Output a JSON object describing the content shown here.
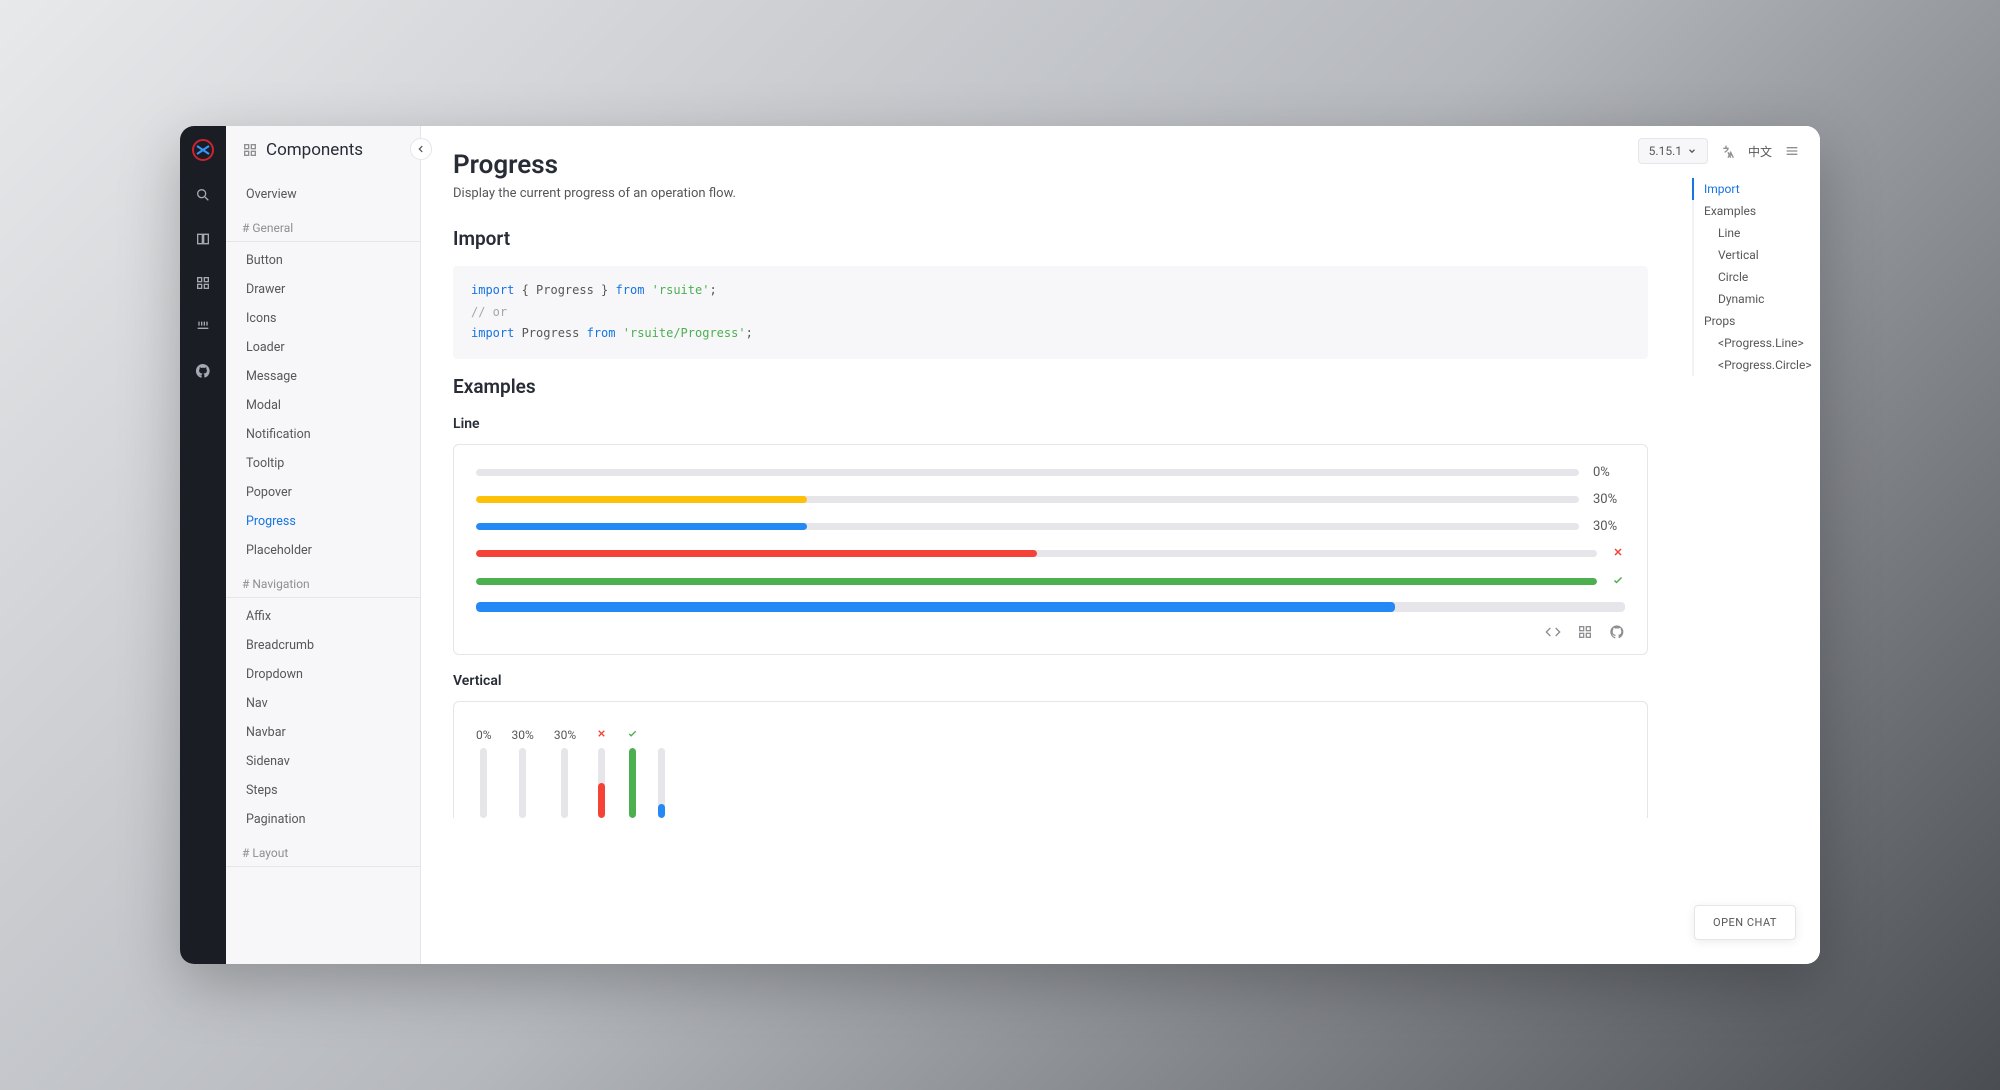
{
  "topbar": {
    "version": "5.15.1",
    "language": "中文",
    "chat_button": "OPEN CHAT"
  },
  "sidebar": {
    "title": "Components",
    "overview": "Overview",
    "sections": [
      {
        "label": "# General",
        "items": [
          "Button",
          "Drawer",
          "Icons",
          "Loader",
          "Message",
          "Modal",
          "Notification",
          "Tooltip",
          "Popover",
          "Progress",
          "Placeholder"
        ],
        "active": "Progress"
      },
      {
        "label": "# Navigation",
        "items": [
          "Affix",
          "Breadcrumb",
          "Dropdown",
          "Nav",
          "Navbar",
          "Sidenav",
          "Steps",
          "Pagination"
        ]
      },
      {
        "label": "# Layout",
        "items": []
      }
    ]
  },
  "page": {
    "title": "Progress",
    "description": "Display the current progress of an operation flow.",
    "h_import": "Import",
    "code_import": "import { Progress } from 'rsuite';\n// or\nimport Progress from 'rsuite/Progress';",
    "h_examples": "Examples",
    "h_line": "Line",
    "h_vertical": "Vertical"
  },
  "examples": {
    "line": [
      {
        "percent": 0,
        "color": "#e5e5ea",
        "label": "0%"
      },
      {
        "percent": 30,
        "color": "#ffc107",
        "label": "30%"
      },
      {
        "percent": 30,
        "color": "#2589f5",
        "label": "30%"
      },
      {
        "percent": 50,
        "color": "#f44336",
        "status": "fail"
      },
      {
        "percent": 100,
        "color": "#4caf50",
        "status": "success"
      },
      {
        "percent": 80,
        "color": "#2589f5",
        "strokeWidth": 10,
        "nolabel": true
      }
    ],
    "vertical": [
      {
        "percent": 0,
        "color": "#e5e5ea",
        "label": "0%"
      },
      {
        "percent": 30,
        "color": "#e5e5ea",
        "label": "30%"
      },
      {
        "percent": 30,
        "color": "#e5e5ea",
        "label": "30%"
      },
      {
        "percent": 50,
        "color": "#f44336",
        "status": "fail"
      },
      {
        "percent": 100,
        "color": "#4caf50",
        "status": "success"
      },
      {
        "percent": 20,
        "color": "#2589f5"
      }
    ]
  },
  "toc": [
    {
      "label": "Import",
      "active": true
    },
    {
      "label": "Examples"
    },
    {
      "label": "Line",
      "sub": true
    },
    {
      "label": "Vertical",
      "sub": true
    },
    {
      "label": "Circle",
      "sub": true
    },
    {
      "label": "Dynamic",
      "sub": true
    },
    {
      "label": "Props"
    },
    {
      "label": "<Progress.Line>",
      "sub": true
    },
    {
      "label": "<Progress.Circle>",
      "sub": true
    }
  ],
  "colors": {
    "primary": "#1675e0"
  }
}
